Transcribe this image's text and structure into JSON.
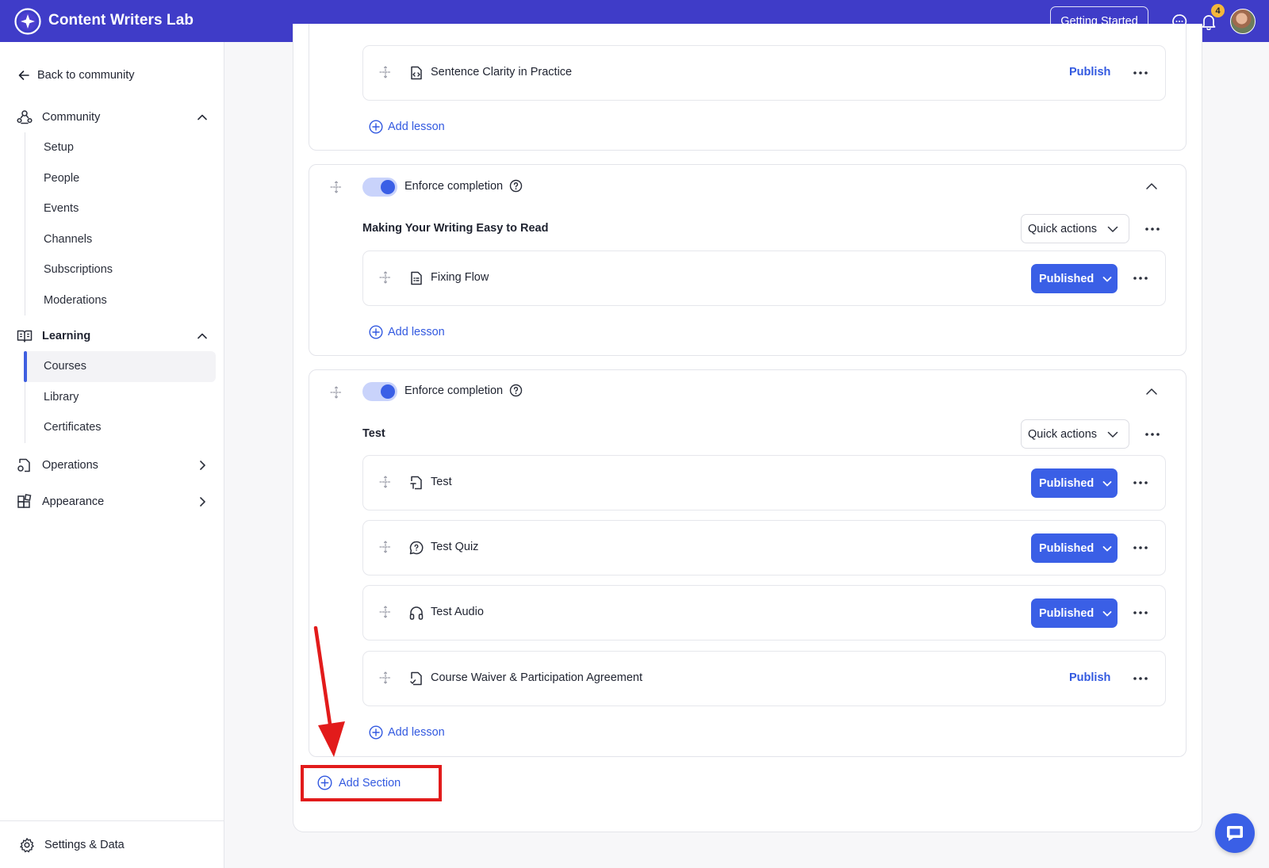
{
  "app": {
    "title": "Content Writers Lab",
    "getting_started": "Getting Started",
    "notification_count": "4"
  },
  "sidebar": {
    "back": "Back to community",
    "community": {
      "label": "Community",
      "items": [
        "Setup",
        "People",
        "Events",
        "Channels",
        "Subscriptions",
        "Moderations"
      ]
    },
    "learning": {
      "label": "Learning",
      "items": [
        "Courses",
        "Library",
        "Certificates"
      ],
      "active": "Courses"
    },
    "operations": "Operations",
    "appearance": "Appearance",
    "settings": "Settings & Data"
  },
  "content": {
    "add_lesson": "Add lesson",
    "add_section": "Add Section",
    "enforce_label": "Enforce completion",
    "quick_actions": "Quick actions",
    "published": "Published",
    "publish": "Publish",
    "section0": {
      "lessons": [
        {
          "name": "Sentence Clarity in Practice",
          "status": "Publish"
        }
      ]
    },
    "section1": {
      "title": "Making Your Writing Easy to Read",
      "lessons": [
        {
          "name": "Fixing Flow",
          "status": "Published"
        }
      ]
    },
    "section2": {
      "title": "Test",
      "lessons": [
        {
          "name": "Test",
          "status": "Published"
        },
        {
          "name": "Test Quiz",
          "status": "Published"
        },
        {
          "name": "Test Audio",
          "status": "Published"
        },
        {
          "name": "Course Waiver & Participation Agreement",
          "status": "Publish"
        }
      ]
    }
  },
  "colors": {
    "topbar": "#3f3cc8",
    "primary": "#3a5fe6",
    "link": "#3259e0",
    "highlight": "#e21b1b",
    "badge": "#f4b73a"
  }
}
